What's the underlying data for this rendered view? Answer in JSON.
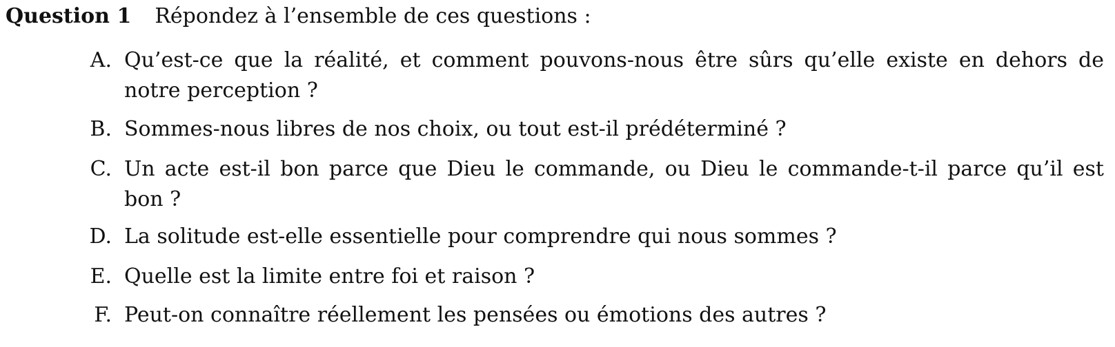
{
  "question": {
    "label": "Question 1",
    "prompt": "Répondez à l’ensemble de ces questions :"
  },
  "items": [
    {
      "letter": "A.",
      "lines": [
        "Qu’est-ce que la réalité, et comment pouvons-nous être sûrs qu’elle existe en dehors de",
        "notre perception ?"
      ]
    },
    {
      "letter": "B.",
      "lines": [
        "Sommes-nous libres de nos choix, ou tout est-il prédéterminé ?"
      ]
    },
    {
      "letter": "C.",
      "lines": [
        "Un acte est-il bon parce que Dieu le commande, ou Dieu le commande-t-il parce qu’il est",
        "bon ?"
      ]
    },
    {
      "letter": "D.",
      "lines": [
        "La solitude est-elle essentielle pour comprendre qui nous sommes ?"
      ]
    },
    {
      "letter": "E.",
      "lines": [
        "Quelle est la limite entre foi et raison ?"
      ]
    },
    {
      "letter": "F.",
      "lines": [
        "Peut-on connaître réellement les pensées ou émotions des autres ?"
      ]
    }
  ]
}
